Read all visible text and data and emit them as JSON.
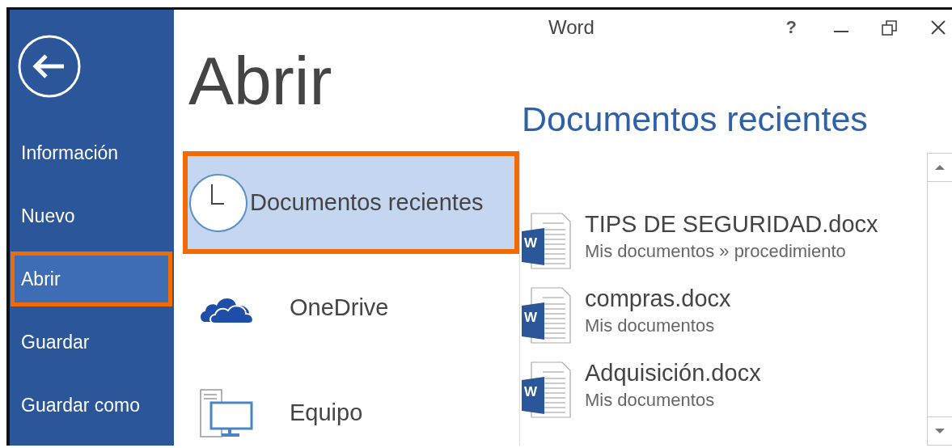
{
  "window": {
    "title": "Word",
    "help_glyph": "?"
  },
  "sidebar": {
    "items": [
      {
        "label": "Información",
        "selected": false
      },
      {
        "label": "Nuevo",
        "selected": false
      },
      {
        "label": "Abrir",
        "selected": true
      },
      {
        "label": "Guardar",
        "selected": false
      },
      {
        "label": "Guardar como",
        "selected": false
      }
    ]
  },
  "page_title": "Abrir",
  "places": [
    {
      "kind": "recent",
      "label": "Documentos recientes",
      "selected": true
    },
    {
      "kind": "onedrive",
      "label": "OneDrive",
      "selected": false
    },
    {
      "kind": "computer",
      "label": "Equipo",
      "selected": false
    }
  ],
  "recent": {
    "heading": "Documentos recientes",
    "files": [
      {
        "name": "TIPS DE SEGURIDAD.docx",
        "path": "Mis documentos » procedimiento",
        "badge": "W"
      },
      {
        "name": "compras.docx",
        "path": "Mis documentos",
        "badge": "W"
      },
      {
        "name": "Adquisición.docx",
        "path": "Mis documentos",
        "badge": "W"
      }
    ]
  }
}
